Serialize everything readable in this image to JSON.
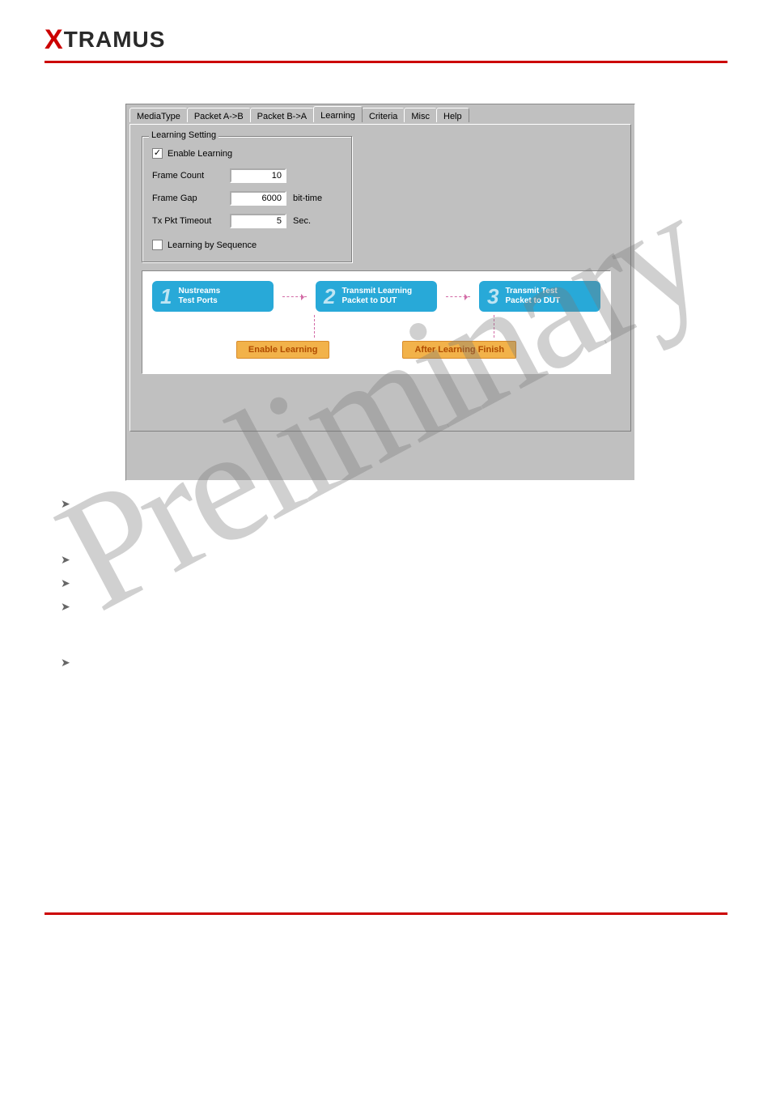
{
  "brand": {
    "x": "X",
    "rest": "TRAMUS"
  },
  "watermark": "Preliminary",
  "tabs": [
    {
      "label": "MediaType"
    },
    {
      "label": "Packet A->B"
    },
    {
      "label": "Packet B->A"
    },
    {
      "label": "Learning"
    },
    {
      "label": "Criteria"
    },
    {
      "label": "Misc"
    },
    {
      "label": "Help"
    }
  ],
  "group": {
    "title": "Learning Setting",
    "enable_label": "Enable Learning",
    "enable_checked": "✓",
    "frame_count_label": "Frame Count",
    "frame_count_value": "10",
    "frame_gap_label": "Frame Gap",
    "frame_gap_value": "6000",
    "frame_gap_unit": "bit-time",
    "tx_timeout_label": "Tx Pkt Timeout",
    "tx_timeout_value": "5",
    "tx_timeout_unit": "Sec.",
    "seq_label": "Learning by Sequence",
    "seq_checked": ""
  },
  "diagram": {
    "steps": [
      {
        "n": "1",
        "line1": "Nustreams",
        "line2": "Test Ports"
      },
      {
        "n": "2",
        "line1": "Transmit Learning",
        "line2": "Packet to DUT"
      },
      {
        "n": "3",
        "line1": "Transmit Test",
        "line2": "Packet to DUT"
      }
    ],
    "pill1": "Enable Learning",
    "pill2": "After Learning Finish"
  },
  "bullets": [
    "",
    "",
    "",
    "",
    ""
  ]
}
